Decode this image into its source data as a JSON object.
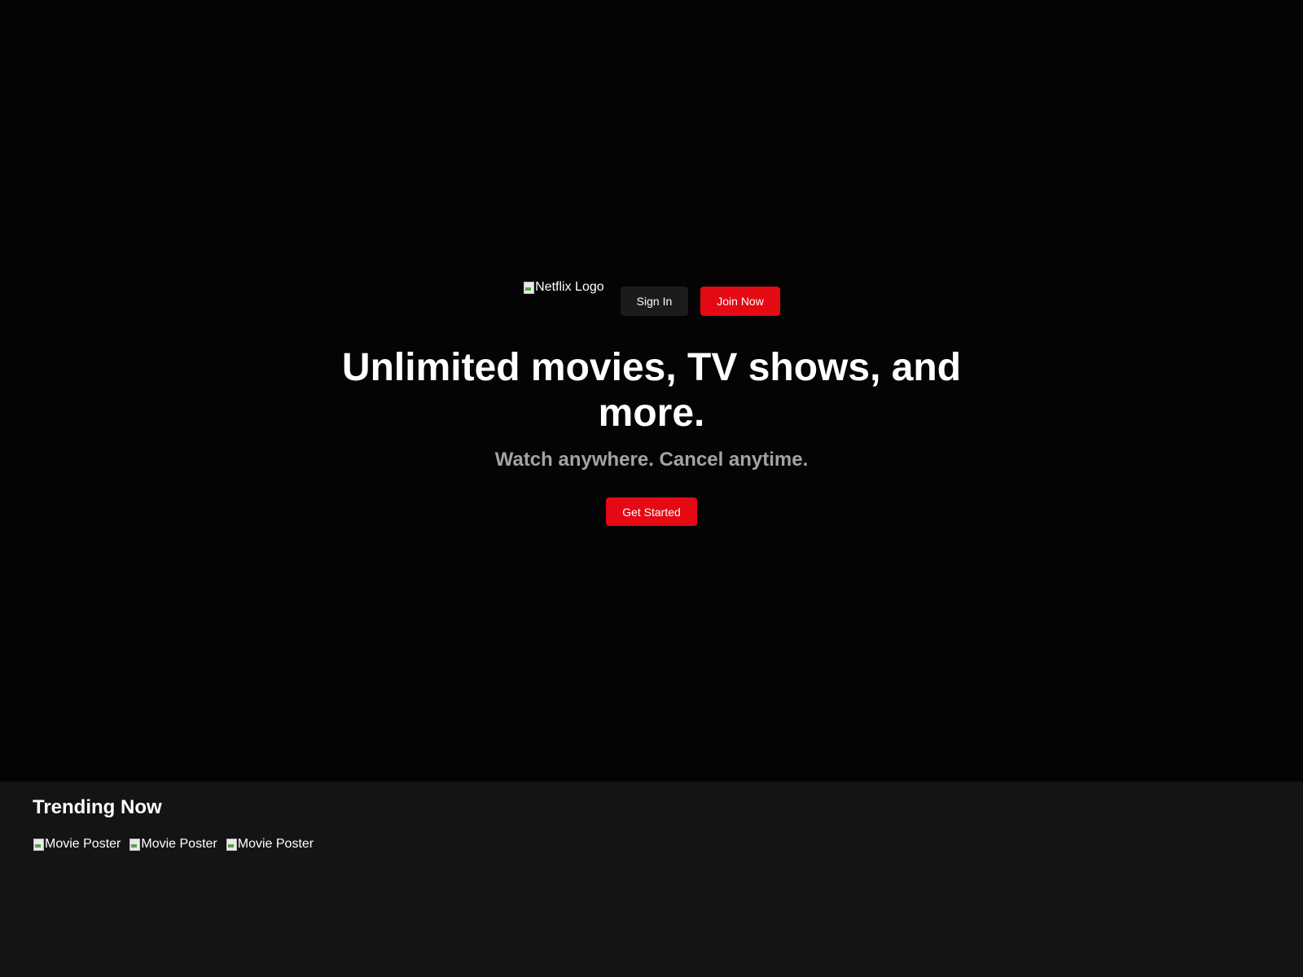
{
  "hero": {
    "logo_alt": "Netflix Logo",
    "sign_in_label": "Sign In",
    "join_now_label": "Join Now",
    "headline": "Unlimited movies, TV shows, and more.",
    "subline": "Watch anywhere. Cancel anytime.",
    "get_started_label": "Get Started"
  },
  "trending": {
    "title": "Trending Now",
    "posters": [
      {
        "alt": "Movie Poster"
      },
      {
        "alt": "Movie Poster"
      },
      {
        "alt": "Movie Poster"
      }
    ]
  },
  "colors": {
    "brand_red": "#e50914",
    "hero_bg": "#040404",
    "section_bg": "#141414",
    "subtext": "#a3a3a3"
  },
  "icons": {
    "broken_image": "broken-image-icon"
  }
}
